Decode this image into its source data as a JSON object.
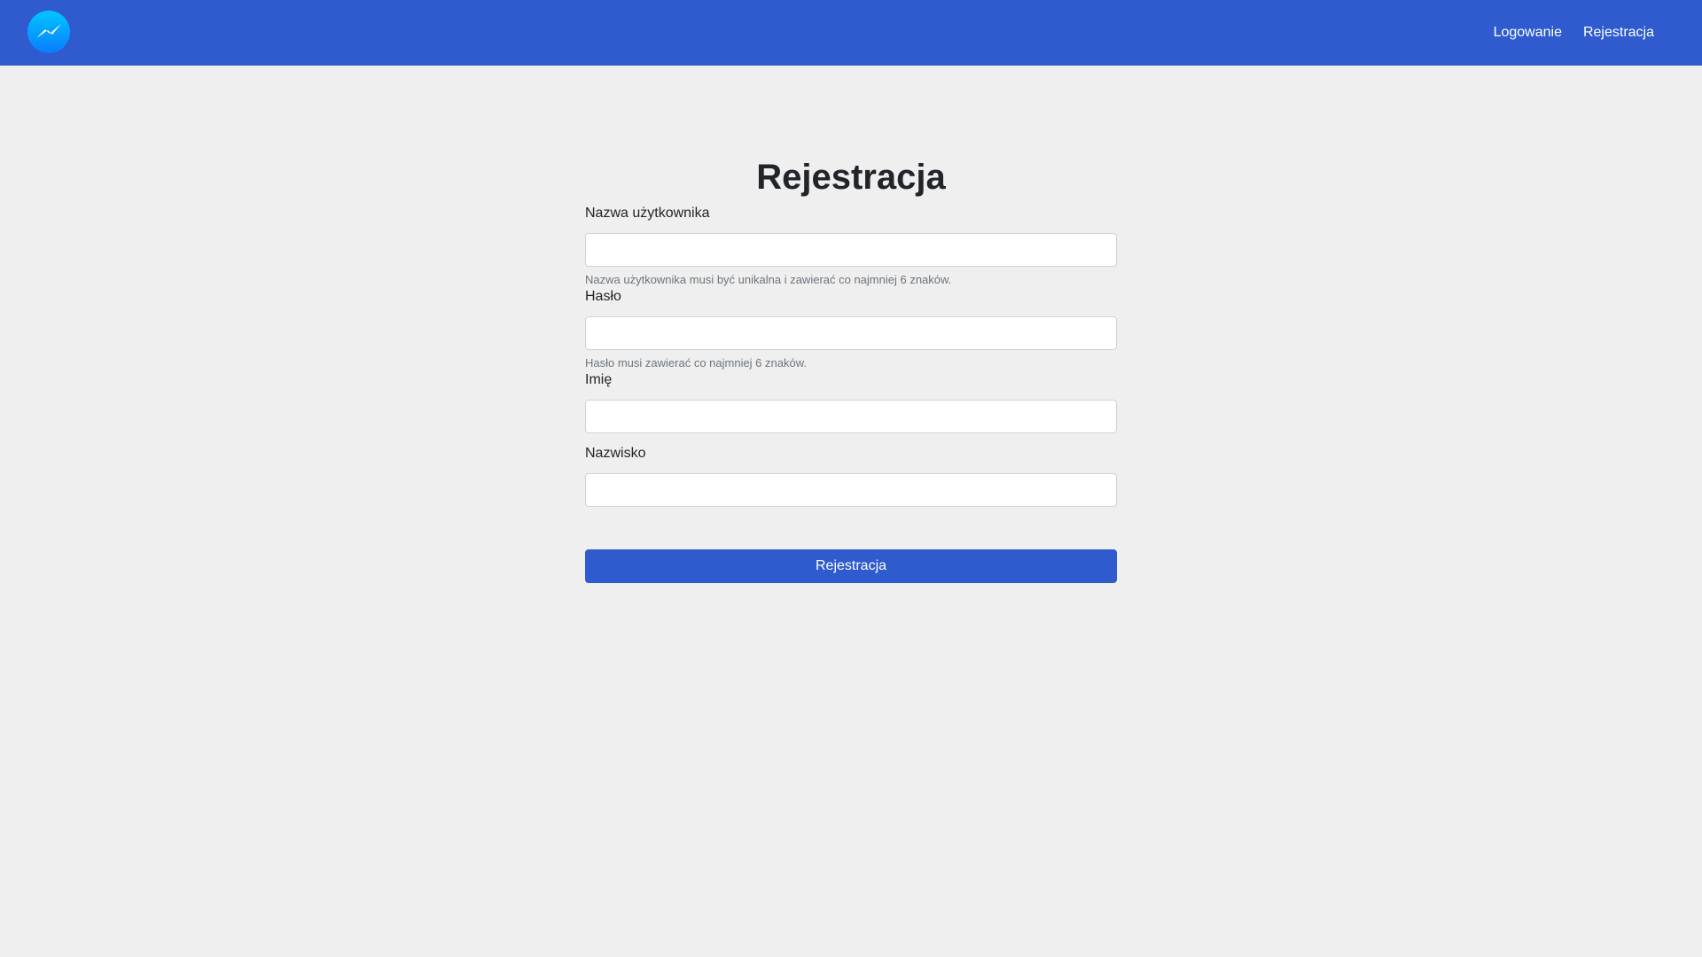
{
  "colors": {
    "navbar": "#2f5bcf",
    "background": "#efefef",
    "button": "#2f5bcf",
    "logo_gradient_top": "#00c6ff",
    "logo_gradient_bottom": "#0a7cff"
  },
  "navbar": {
    "logo_icon": "messenger-logo-icon",
    "links": [
      {
        "label": "Logowanie"
      },
      {
        "label": "Rejestracja"
      }
    ]
  },
  "form": {
    "title": "Rejestracja",
    "fields": [
      {
        "label": "Nazwa użytkownika",
        "value": "",
        "help": "Nazwa użytkownika musi być unikalna i zawierać co najmniej 6 znaków."
      },
      {
        "label": "Hasło",
        "value": "",
        "help": "Hasło musi zawierać co najmniej 6 znaków."
      },
      {
        "label": "Imię",
        "value": ""
      },
      {
        "label": "Nazwisko",
        "value": ""
      }
    ],
    "submit_label": "Rejestracja"
  }
}
